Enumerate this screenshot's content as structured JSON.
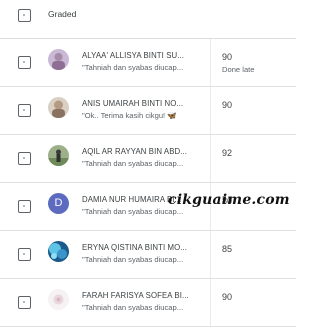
{
  "header": {
    "label": "Graded"
  },
  "students": [
    {
      "name": "ALYAA' ALLISYA BINTI SU...",
      "comment": "\"Tahniah dan syabas diucap...",
      "grade": "90",
      "status": "Done late",
      "avatar_icon": "photo-avatar"
    },
    {
      "name": "ANIS UMAIRAH BINTI NO...",
      "comment": "\"Ok.. Terima kasih cikgu! 🦋",
      "grade": "90",
      "status": "",
      "avatar_icon": "photo-avatar"
    },
    {
      "name": "AQIL AR RAYYAN BIN ABD...",
      "comment": "\"Tahniah dan syabas diucap...",
      "grade": "92",
      "status": "",
      "avatar_icon": "photo-avatar"
    },
    {
      "name": "DAMIA NUR HUMAIRA BI...",
      "comment": "\"Tahniah dan syabas diucap...",
      "grade": "80",
      "status": "",
      "avatar_letter": "D",
      "avatar_color": "#5c6bc0"
    },
    {
      "name": "ERYNA QISTINA BINTI MO...",
      "comment": "\"Tahniah dan syabas diucap...",
      "grade": "85",
      "status": "",
      "avatar_icon": "photo-avatar"
    },
    {
      "name": "FARAH FARISYA SOFEA BI...",
      "comment": "\"Tahniah dan syabas diucap...",
      "grade": "90",
      "status": "",
      "avatar_icon": "photo-avatar"
    }
  ],
  "watermark": "cikguaime.com"
}
